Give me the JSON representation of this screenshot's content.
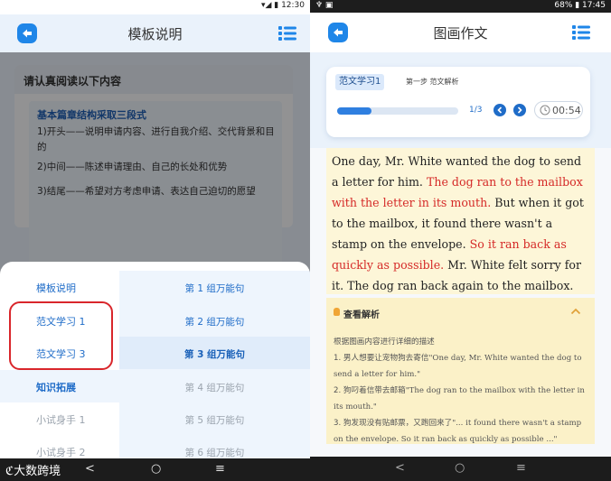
{
  "left_screen": {
    "status": {
      "time": "12:30"
    },
    "appbar": {
      "title": "模板说明",
      "back_icon": "back-icon",
      "menu_icon": "list-menu-icon"
    },
    "card": {
      "header": "请认真阅读以下内容",
      "subheading": "基本篇章结构采取三段式",
      "lines": [
        "1)开头——说明申请内容、进行自我介绍、交代背景和目的",
        "2)中间——陈述申请理由、自己的长处和优势",
        "3)结尾——希望对方考虑申请、表达自己迫切的愿望"
      ]
    },
    "sheet": {
      "left_items": [
        "模板说明",
        "范文学习 1",
        "范文学习 3",
        "知识拓展",
        "小试身手 1",
        "小试身手 2"
      ],
      "right_items": [
        "第 1 组万能句",
        "第 2 组万能句",
        "第 3 组万能句",
        "第 4 组万能句",
        "第 5 组万能句",
        "第 6 组万能句"
      ],
      "selected_right_index": 2
    },
    "navbar": {
      "watermark": "大数跨境",
      "back": "<",
      "home": "○",
      "recents": "≡"
    }
  },
  "right_screen": {
    "status": {
      "left": "♆ ▣",
      "right": "68% ▮ 17:45"
    },
    "appbar": {
      "title": "图画作文",
      "back_icon": "back-icon",
      "menu_icon": "list-menu-icon"
    },
    "progress_card": {
      "tag": "范文学习1",
      "step": "第一步 范文解析",
      "progress_fraction": 0.28,
      "page": "1/3",
      "timer": "00:54"
    },
    "essay": {
      "s1": "One day, Mr. White wanted the dog to send a letter for him.",
      "s2": "The dog ran to the mailbox with the letter in its mouth.",
      "s3": "But when it got to the mailbox, it found there wasn't a stamp on the envelope.",
      "s4": "So it ran back as quickly as possible.",
      "s5": "Mr. White felt sorry for it. The dog ran back again to the mailbox."
    },
    "analysis": {
      "header": "查看解析",
      "intro": "根据图画内容进行详细的描述",
      "items": [
        {
          "cn": "1. 男人想要让宠物狗去寄信",
          "en": "\"One day, Mr. White wanted the dog to send a letter for him.\""
        },
        {
          "cn": "2. 狗叼着信带去邮箱",
          "en": "\"The dog ran to the mailbox with the letter in its mouth.\""
        },
        {
          "cn": "3. 狗发现没有贴邮票，又跑回来了",
          "en": "\"... it found there wasn't a stamp on the envelope. So it ran back as quickly as possible ...\""
        }
      ]
    },
    "navbar": {
      "back": "<",
      "home": "○",
      "recents": "≡"
    }
  },
  "colors": {
    "accent": "#1f86e8",
    "highlight_red": "#d52a28",
    "essay_bg": "#fdf6d8",
    "analysis_bg": "#fbf1c8"
  }
}
